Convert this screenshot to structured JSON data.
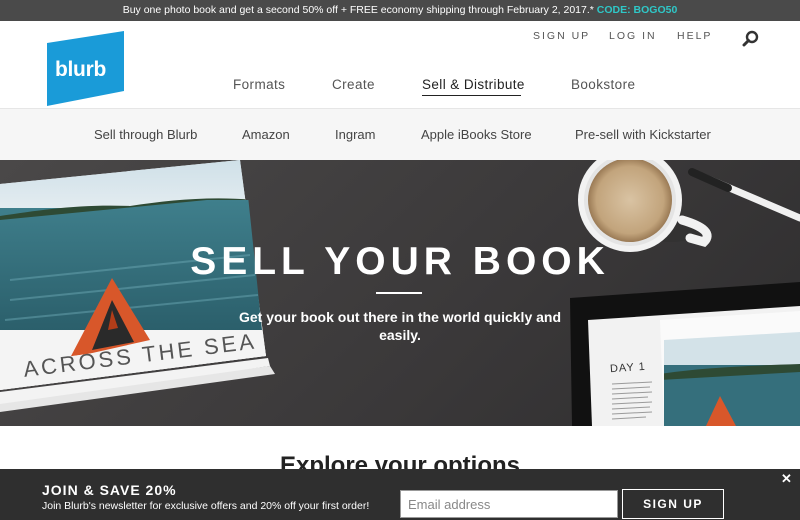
{
  "promo": {
    "text": "Buy one photo book and get a second 50% off + FREE economy shipping through February 2, 2017.* ",
    "code": "CODE: BOGO50"
  },
  "header": {
    "logo_text": "blurb",
    "util_links": {
      "signup": "SIGN UP",
      "login": "LOG IN",
      "help": "HELP"
    },
    "nav": {
      "formats": "Formats",
      "create": "Create",
      "sell": "Sell & Distribute",
      "bookstore": "Bookstore"
    }
  },
  "subnav": {
    "items": [
      "Sell through Blurb",
      "Amazon",
      "Ingram",
      "Apple iBooks Store",
      "Pre-sell with Kickstarter"
    ]
  },
  "hero": {
    "title": "SELL YOUR BOOK",
    "subtitle": "Get your book out there in the world quickly and easily.",
    "book_cover_text": "ACROSS THE SEA",
    "tablet_text": "DAY 1"
  },
  "content": {
    "heading": "Explore your options"
  },
  "newsletter": {
    "title": "JOIN & SAVE 20%",
    "desc": "Join Blurb's newsletter for exclusive offers and 20% off your first order!",
    "email_placeholder": "Email address",
    "signup_label": "SIGN UP",
    "close_label": "✕"
  },
  "colors": {
    "brand": "#1a9bd8",
    "code": "#2fc7c7",
    "bar": "#2f2f2f"
  }
}
